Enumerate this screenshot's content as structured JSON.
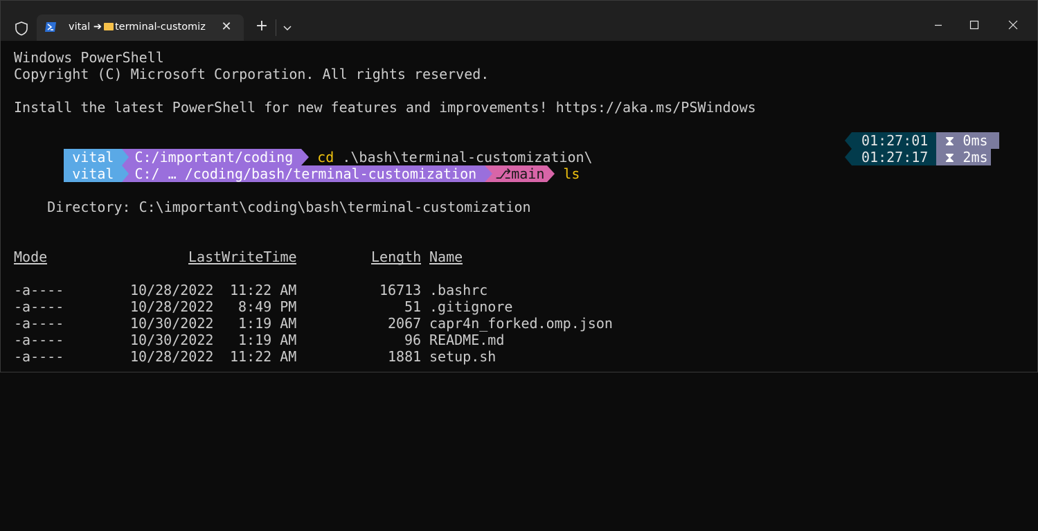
{
  "window": {
    "tab_title_user": "vital",
    "tab_title_arrow": "➔",
    "tab_title_folder": "terminal-customiz",
    "tab_close": "✕",
    "new_tab": "+",
    "icons": [
      "shield-icon",
      "powershell-icon",
      "folder-icon",
      "close-icon",
      "plus-icon",
      "chevron-down-icon",
      "minimize-icon",
      "maximize-icon",
      "window-close-icon"
    ]
  },
  "header_lines": {
    "line1": "Windows PowerShell",
    "line2": "Copyright (C) Microsoft Corporation. All rights reserved.",
    "line3": "Install the latest PowerShell for new features and improvements! https://aka.ms/PSWindows"
  },
  "prompt1": {
    "user": "vital",
    "path": "C:/important/coding",
    "command": "cd .\\bash\\terminal-customization\\",
    "time": "01:27:01",
    "duration": "0ms",
    "duration_icon": "hourglass-icon"
  },
  "prompt2": {
    "user": "vital",
    "path": "C:/ … /coding/bash/terminal-customization",
    "branch_icon": "git-branch-icon",
    "branch": "main",
    "command": "ls",
    "time": "01:27:17",
    "duration": "2ms",
    "duration_icon": "hourglass-icon"
  },
  "colors": {
    "user_bg": "#5aa9e6",
    "path_bg": "#9a6fdc",
    "git_bg": "#d865a8",
    "time_bg": "#023b4c",
    "duration_bg": "#7b7b9e",
    "command_yellow": "#f1c40f",
    "text": "#cccccc"
  },
  "listing": {
    "directory_label": "    Directory: C:\\important\\coding\\bash\\terminal-customization",
    "headers": {
      "mode": "Mode",
      "lastwrite": "LastWriteTime",
      "length": "Length",
      "name": "Name"
    },
    "rows": [
      {
        "mode": "-a----",
        "date": "10/28/2022",
        "time": "11:22 AM",
        "length": "16713",
        "name": ".bashrc"
      },
      {
        "mode": "-a----",
        "date": "10/28/2022",
        "time": "8:49 PM",
        "length": "51",
        "name": ".gitignore"
      },
      {
        "mode": "-a----",
        "date": "10/30/2022",
        "time": "1:19 AM",
        "length": "2067",
        "name": "capr4n_forked.omp.json"
      },
      {
        "mode": "-a----",
        "date": "10/30/2022",
        "time": "1:19 AM",
        "length": "96",
        "name": "README.md"
      },
      {
        "mode": "-a----",
        "date": "10/28/2022",
        "time": "11:22 AM",
        "length": "1881",
        "name": "setup.sh"
      }
    ]
  }
}
